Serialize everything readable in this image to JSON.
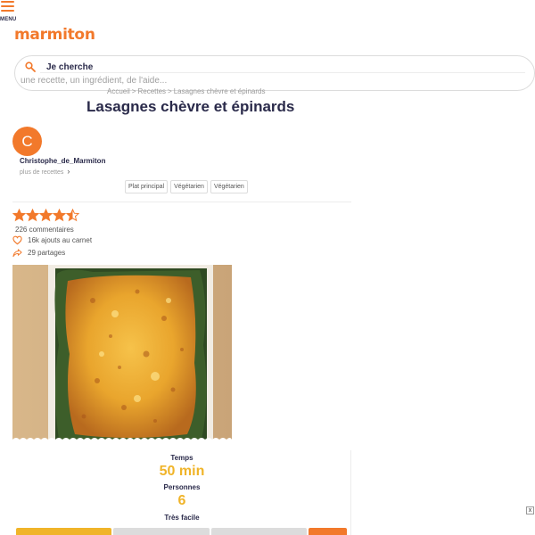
{
  "header": {
    "menu_label": "MENU",
    "logo_text": "marmiton",
    "brand_color": "#f2792b"
  },
  "search": {
    "title": "Je cherche",
    "placeholder": "une recette, un ingrédient, de l'aide..."
  },
  "breadcrumb": [
    "Accueil",
    "Recettes",
    "Lasagnes chèvre et épinards"
  ],
  "recipe": {
    "title": "Lasagnes chèvre et épinards",
    "author": {
      "initial": "C",
      "name": "Christophe_de_Marmiton",
      "more_label": "plus de recettes"
    },
    "tags": [
      "Plat principal",
      "Végétarien",
      "Végétarien"
    ],
    "rating": 4.5,
    "rating_max": 5,
    "comments_label": "226 commentaires",
    "carnet_label": "16k ajouts au carnet",
    "shares_label": "29 partages",
    "info": {
      "time_label": "Temps",
      "time_value": "50 min",
      "people_label": "Personnes",
      "people_value": "6",
      "difficulty_label": "Très facile",
      "accent_color": "#f0b429"
    }
  },
  "ad": {
    "close_label": "x"
  }
}
